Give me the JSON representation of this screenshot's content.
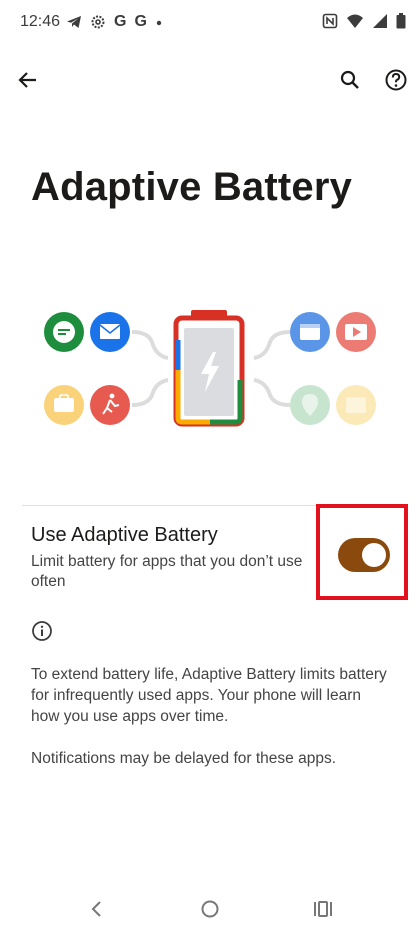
{
  "status_bar": {
    "time": "12:46",
    "left_icons": [
      "telegram-icon",
      "settings-gear-icon",
      "google-icon",
      "google-icon",
      "dot-icon"
    ],
    "g1": "G",
    "g2": "G",
    "right_icons": [
      "nfc-icon",
      "wifi-icon",
      "signal-icon",
      "battery-icon"
    ]
  },
  "top_bar": {
    "icons": [
      "back-arrow-icon",
      "search-icon",
      "help-icon"
    ]
  },
  "page": {
    "title": "Adaptive Battery"
  },
  "illustration": {
    "left_apps": [
      "chat-icon",
      "mail-icon",
      "briefcase-icon",
      "fitness-icon"
    ],
    "right_apps": [
      "calendar-icon",
      "video-icon",
      "maps-icon",
      "photos-icon"
    ],
    "battery_icon": "battery-bolt-icon",
    "colors": {
      "green": "#1e8e3e",
      "blue": "#1a73e8",
      "yellow": "#f9d27a",
      "red": "#e65a4f",
      "battery_red": "#d93025",
      "battery_yellow": "#f9ab00"
    }
  },
  "setting": {
    "title": "Use Adaptive Battery",
    "summary": "Limit battery for apps that you don’t use often",
    "toggle_on": true,
    "toggle_color": "#8a4a0e",
    "highlight_color": "#e3101e"
  },
  "info": {
    "paragraph1": "To extend battery life, Adaptive Battery limits battery for infrequently used apps. Your phone will learn how you use apps over time.",
    "paragraph2": "Notifications may be delayed for these apps."
  },
  "nav_bar": {
    "icons": [
      "nav-back-icon",
      "nav-home-icon",
      "nav-recents-icon"
    ]
  }
}
